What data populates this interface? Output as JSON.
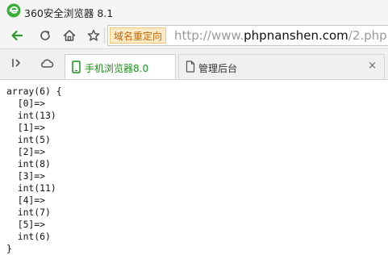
{
  "window": {
    "title": "360安全浏览器 8.1",
    "logo_icon": "360-browser-logo-icon"
  },
  "toolbar": {
    "back_icon": "back-arrow-icon",
    "reload_icon": "reload-icon",
    "home_icon": "home-icon",
    "favorite_icon": "star-icon"
  },
  "address_bar": {
    "badge": "域名重定向",
    "url_prefix": "http://www.",
    "url_host": "phpnanshen.com",
    "url_suffix": "/2.php"
  },
  "tabs": [
    {
      "label": "手机浏览器8.0",
      "icon": "mobile-phone-icon",
      "active": true
    },
    {
      "label": "管理后台",
      "icon": "document-icon",
      "active": false
    }
  ],
  "tabbar": {
    "sidebar_toggle_icon": "sidebar-toggle-icon",
    "cloud_icon": "cloud-icon",
    "close_glyph": "×"
  },
  "content": {
    "lines": [
      "array(6) {",
      "  [0]=>",
      "  int(13)",
      "  [1]=>",
      "  int(5)",
      "  [2]=>",
      "  int(8)",
      "  [3]=>",
      "  int(11)",
      "  [4]=>",
      "  int(7)",
      "  [5]=>",
      "  int(6)",
      "}"
    ]
  },
  "colors": {
    "accent_green": "#1a8f1a",
    "badge_bg": "#fdebc8",
    "badge_text": "#c0670a"
  }
}
